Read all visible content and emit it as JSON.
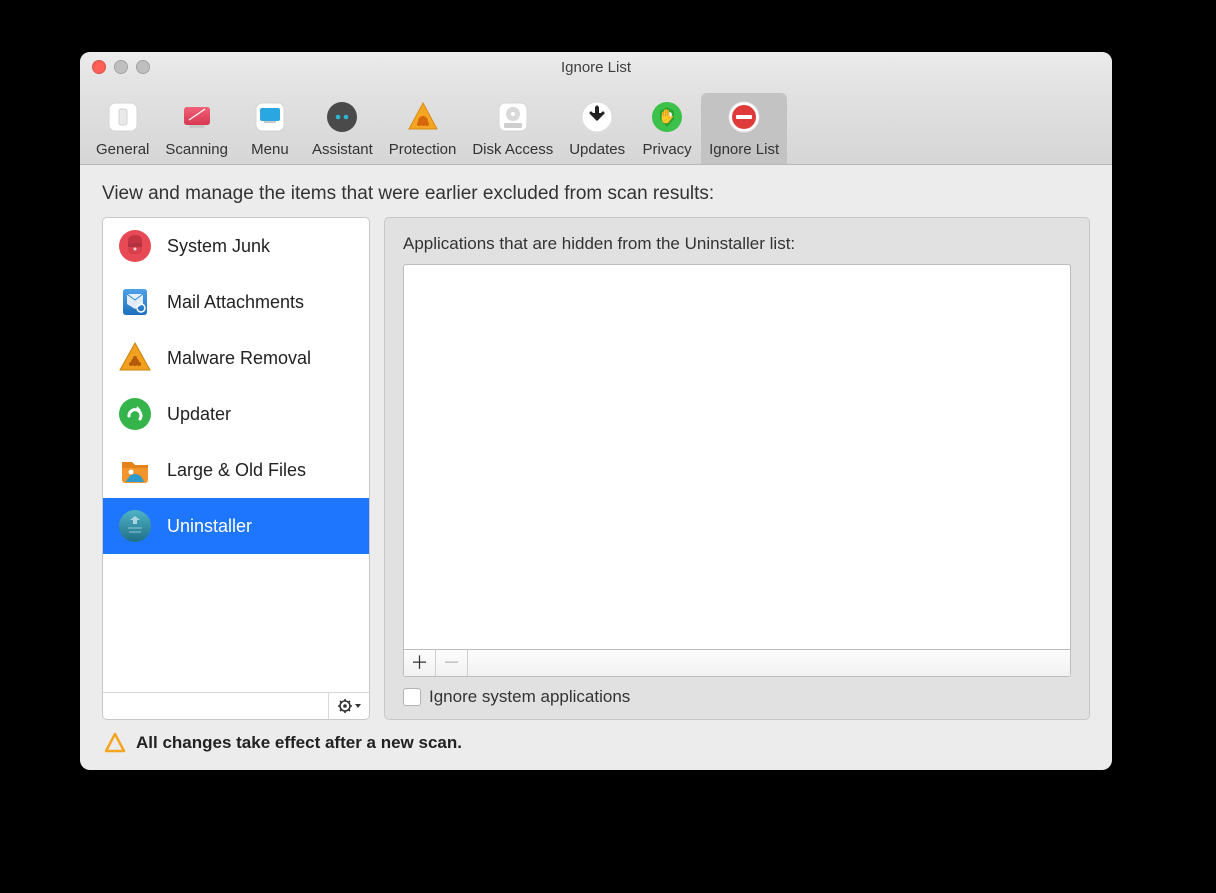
{
  "window": {
    "title": "Ignore List"
  },
  "toolbar": {
    "tabs": [
      {
        "label": "General"
      },
      {
        "label": "Scanning"
      },
      {
        "label": "Menu"
      },
      {
        "label": "Assistant"
      },
      {
        "label": "Protection"
      },
      {
        "label": "Disk Access"
      },
      {
        "label": "Updates"
      },
      {
        "label": "Privacy"
      },
      {
        "label": "Ignore List"
      }
    ],
    "selected_index": 8
  },
  "description": "View and manage the items that were earlier excluded from scan results:",
  "sidebar": {
    "items": [
      {
        "label": "System Junk"
      },
      {
        "label": "Mail Attachments"
      },
      {
        "label": "Malware Removal"
      },
      {
        "label": "Updater"
      },
      {
        "label": "Large & Old Files"
      },
      {
        "label": "Uninstaller"
      }
    ],
    "selected_index": 5
  },
  "main": {
    "heading": "Applications that are hidden from the Uninstaller list:",
    "checkbox_label": "Ignore system applications",
    "checkbox_checked": false
  },
  "controls": {
    "add": "＋",
    "remove": "－"
  },
  "footer_note": "All changes take effect after a new scan."
}
